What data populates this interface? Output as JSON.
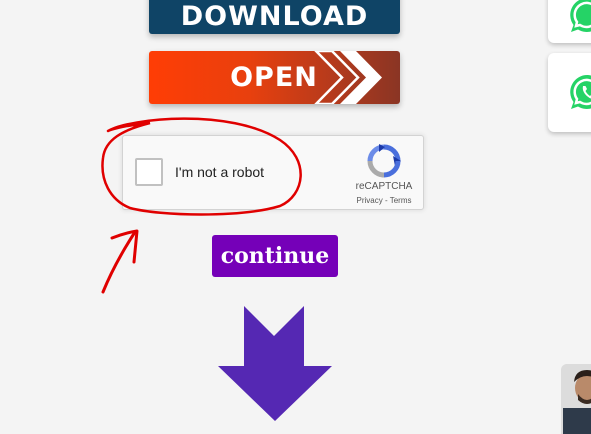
{
  "download_button": {
    "label": "DOWNLOAD"
  },
  "open_button": {
    "label": "OPEN"
  },
  "recaptcha": {
    "checkbox_label": "I'm not a robot",
    "brand": "reCAPTCHA",
    "privacy_link": "Privacy",
    "separator": "-",
    "terms_link": "Terms"
  },
  "continue_button": {
    "label": "continue"
  },
  "side_widgets": [
    {
      "icon": "whatsapp-icon"
    },
    {
      "icon": "whatsapp-icon"
    }
  ],
  "colors": {
    "download_bg": "#0f4466",
    "open_gradient_start": "#ff3d05",
    "continue_bg": "#7500b8",
    "arrow": "#5528b3",
    "annotation": "#e00000",
    "whatsapp": "#25d366"
  }
}
